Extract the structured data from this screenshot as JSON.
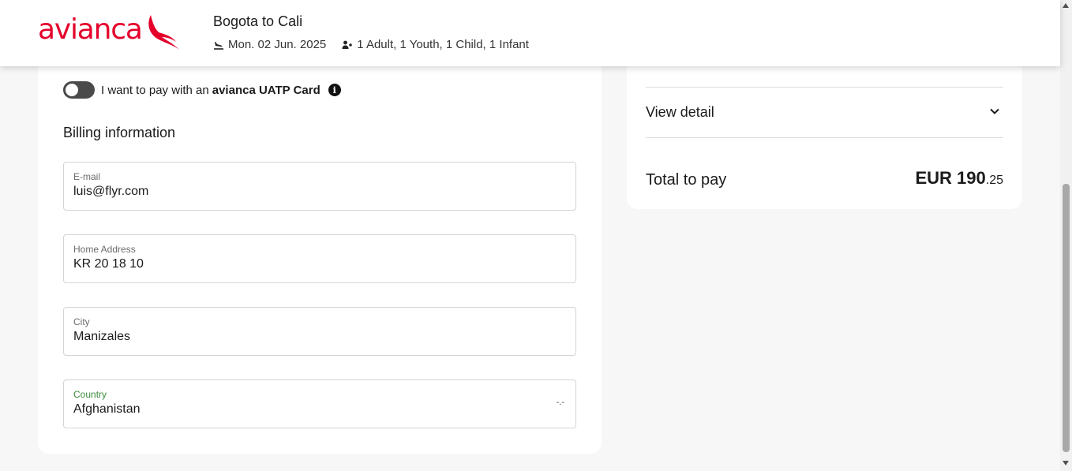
{
  "header": {
    "brand": "avianca",
    "route": "Bogota to Cali",
    "date": "Mon. 02 Jun. 2025",
    "passengers": "1 Adult, 1 Youth, 1 Child, 1 Infant"
  },
  "uatp": {
    "text_prefix": "I want to pay with an",
    "text_bold": "avianca UATP Card",
    "toggle_on": false,
    "info_glyph": "i"
  },
  "billing": {
    "title": "Billing information",
    "fields": [
      {
        "label": "E-mail",
        "value": "luis@flyr.com"
      },
      {
        "label": "Home Address",
        "value": "KR 20 18 10"
      },
      {
        "label": "City",
        "value": "Manizales"
      },
      {
        "label": "Country",
        "value": "Afghanistan",
        "caret": "-.-"
      }
    ]
  },
  "summary": {
    "view_detail": "View detail",
    "total_label": "Total to pay",
    "total_main": "EUR 190",
    "total_cents": ".25"
  },
  "colors": {
    "brand_red": "#e4002b",
    "country_label_green": "#3c8c3c"
  },
  "icons": {
    "date": "plane-landing-icon",
    "passengers": "people-icon",
    "info": "info-icon",
    "chevron": "chevron-down-icon"
  }
}
